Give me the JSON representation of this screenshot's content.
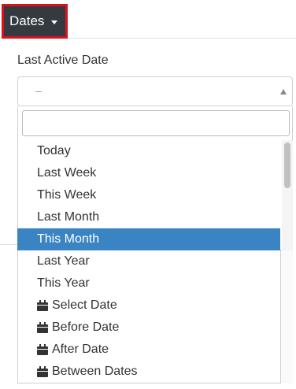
{
  "toolbar": {
    "dates_label": "Dates"
  },
  "filter": {
    "label": "Last Active Date",
    "selected_value": "–",
    "search_placeholder": ""
  },
  "options": [
    {
      "label": "Today",
      "icon": ""
    },
    {
      "label": "Last Week",
      "icon": ""
    },
    {
      "label": "This Week",
      "icon": ""
    },
    {
      "label": "Last Month",
      "icon": ""
    },
    {
      "label": "This Month",
      "icon": "",
      "selected": true
    },
    {
      "label": "Last Year",
      "icon": ""
    },
    {
      "label": "This Year",
      "icon": ""
    },
    {
      "label": "Select Date",
      "icon": "calendar-icon"
    },
    {
      "label": "Before Date",
      "icon": "calendar-icon"
    },
    {
      "label": "After Date",
      "icon": "calendar-icon"
    },
    {
      "label": "Between Dates",
      "icon": "calendar-icon"
    }
  ],
  "colors": {
    "button_bg": "#343a40",
    "highlight_border": "#d9111b",
    "selected_bg": "#3a84c4"
  }
}
